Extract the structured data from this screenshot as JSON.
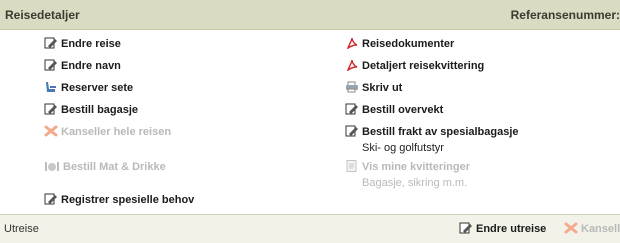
{
  "header": {
    "title": "Reisedetaljer",
    "reference_label": "Referansenummer:"
  },
  "left_actions": [
    {
      "label": "Endre reise",
      "icon": "edit-icon",
      "enabled": true
    },
    {
      "label": "Endre navn",
      "icon": "edit-icon",
      "enabled": true
    },
    {
      "label": "Reserver sete",
      "icon": "seat-icon",
      "enabled": true
    },
    {
      "label": "Bestill bagasje",
      "icon": "edit-icon",
      "enabled": true
    },
    {
      "label": "Kanseller hele reisen",
      "icon": "cancel-icon",
      "enabled": false
    },
    {
      "label": "Bestill Mat & Drikke",
      "icon": "food-icon",
      "enabled": false
    },
    {
      "label": "Registrer spesielle behov",
      "icon": "edit-icon",
      "enabled": true
    }
  ],
  "right_actions": [
    {
      "label": "Reisedokumenter",
      "icon": "pdf-icon",
      "enabled": true
    },
    {
      "label": "Detaljert reisekvittering",
      "icon": "pdf-icon",
      "enabled": true
    },
    {
      "label": "Skriv ut",
      "icon": "print-icon",
      "enabled": true
    },
    {
      "label": "Bestill overvekt",
      "icon": "edit-icon",
      "enabled": true
    },
    {
      "label": "Bestill frakt av spesialbagasje",
      "icon": "edit-icon",
      "enabled": true,
      "sublabel": "Ski- og golfutstyr"
    },
    {
      "label": "Vis mine kvitteringer",
      "icon": "document-icon",
      "enabled": false,
      "sublabel": "Bagasje, sikring m.m."
    }
  ],
  "footer": {
    "label": "Utreise",
    "edit_label": "Endre utreise",
    "cancel_label": "Kanseller"
  },
  "colors": {
    "header_bg": "#d9dcc2",
    "disabled_text": "#b9b9b9",
    "pdf_red": "#d2262a",
    "cancel_orange": "#f08a63"
  }
}
